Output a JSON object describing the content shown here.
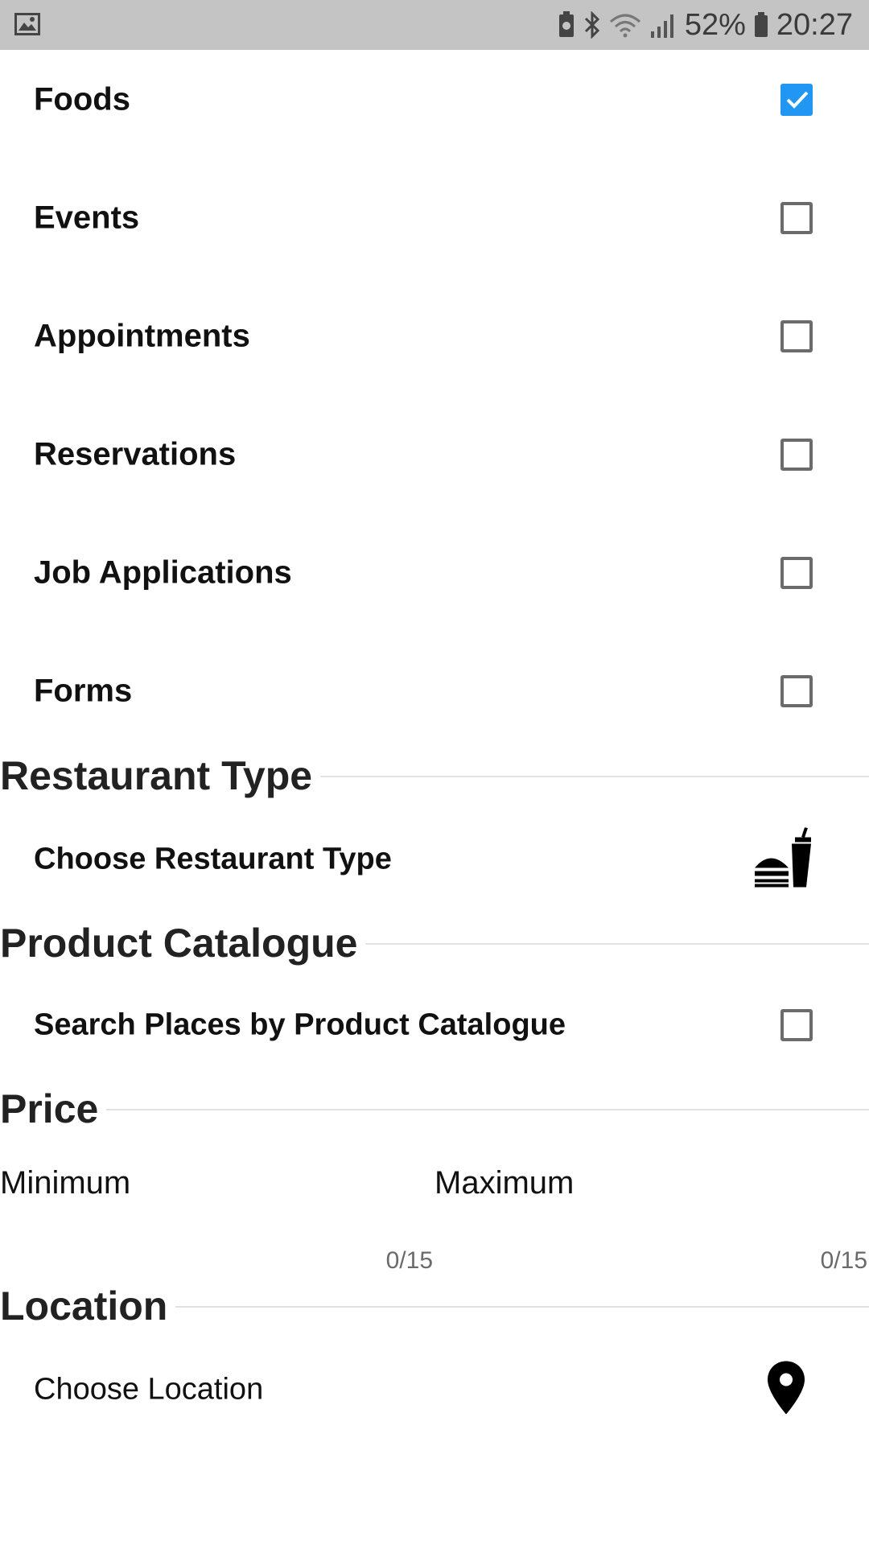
{
  "status_bar": {
    "battery_percent": "52%",
    "time": "20:27",
    "icons": [
      "image-icon",
      "battery-saver-icon",
      "bluetooth-icon",
      "wifi-icon",
      "signal-icon",
      "battery-icon"
    ]
  },
  "categories": [
    {
      "label": "Foods",
      "checked": true
    },
    {
      "label": "Events",
      "checked": false
    },
    {
      "label": "Appointments",
      "checked": false
    },
    {
      "label": "Reservations",
      "checked": false
    },
    {
      "label": "Job Applications",
      "checked": false
    },
    {
      "label": "Forms",
      "checked": false
    }
  ],
  "restaurant_type": {
    "section_title": "Restaurant Type",
    "action_label": "Choose Restaurant Type",
    "icon": "fastfood-icon"
  },
  "product_catalogue": {
    "section_title": "Product Catalogue",
    "option_label": "Search Places by Product Catalogue",
    "checked": false
  },
  "price": {
    "section_title": "Price",
    "minimum_label": "Minimum",
    "minimum_counter": "0/15",
    "maximum_label": "Maximum",
    "maximum_counter": "0/15"
  },
  "location": {
    "section_title": "Location",
    "action_label": "Choose Location",
    "icon": "location-pin-icon"
  },
  "colors": {
    "accent": "#2196f3",
    "status_bar": "#c4c4c4"
  }
}
